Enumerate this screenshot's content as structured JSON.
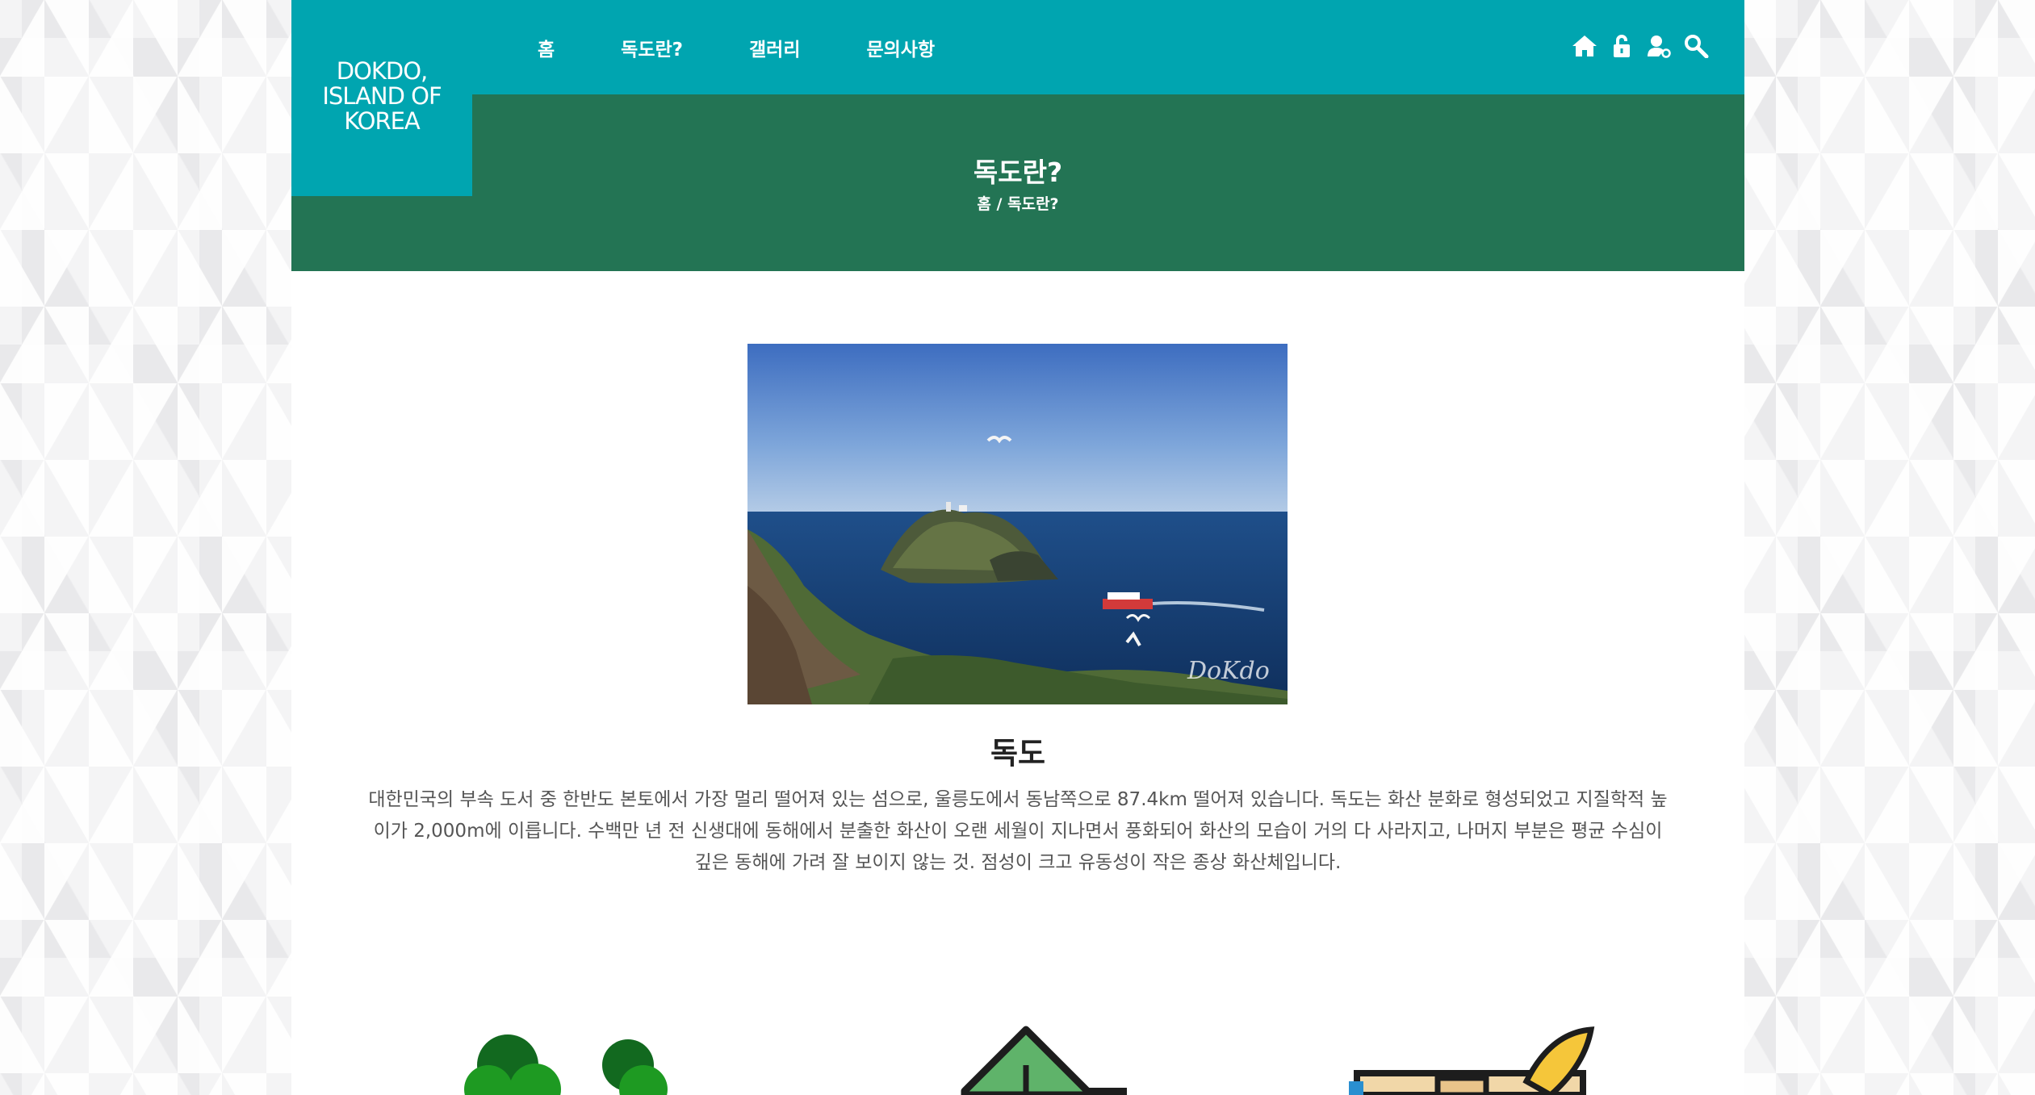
{
  "logo": {
    "text": "DOKDO, ISLAND OF KOREA"
  },
  "nav": {
    "items": [
      "홈",
      "독도란?",
      "갤러리",
      "문의사항"
    ]
  },
  "utility": {
    "icons": [
      "home-icon",
      "lock-icon",
      "user-join-icon",
      "search-icon"
    ]
  },
  "subheader": {
    "title": "독도란?",
    "breadcrumb": {
      "home": "홈",
      "separator": "/",
      "current": "독도란?"
    }
  },
  "photo": {
    "watermark": "DoKdo"
  },
  "content": {
    "title": "독도",
    "description": "대한민국의 부속 도서 중 한반도 본토에서 가장 멀리 떨어져 있는 섬으로, 울릉도에서 동남쪽으로 87.4km 떨어져 있습니다. 독도는 화산 분화로 형성되었고 지질학적 높이가 2,000m에 이릅니다. 수백만 년 전 신생대에 동해에서 분출한 화산이 오랜 세월이 지나면서 풍화되어 화산의 모습이 거의 다 사라지고, 나머지 부분은 평균 수심이 깊은 동해에 가려 잘 보이지 않는 것. 점성이 크고 유동성이 작은 종상 화산체입니다."
  },
  "features": {
    "icons": [
      "trees-icon",
      "leaf-sign-icon",
      "book-quill-icon"
    ]
  },
  "colors": {
    "header_teal": "#00a5b0",
    "subheader_green": "#237454",
    "text_gray": "#555555"
  }
}
